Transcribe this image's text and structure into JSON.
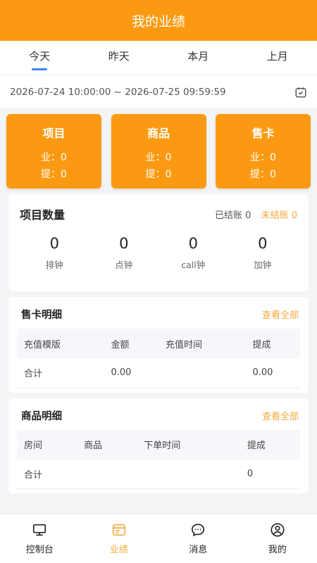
{
  "header": {
    "title": "我的业绩"
  },
  "tabs": [
    {
      "label": "今天",
      "active": true
    },
    {
      "label": "昨天",
      "active": false
    },
    {
      "label": "本月",
      "active": false
    },
    {
      "label": "上月",
      "active": false
    }
  ],
  "daterange": {
    "text": "2026-07-24 10:00:00 ~ 2026-07-25 09:59:59"
  },
  "cards": [
    {
      "title": "项目",
      "ye": "业：0",
      "ti": "提：0"
    },
    {
      "title": "商品",
      "ye": "业：0",
      "ti": "提：0"
    },
    {
      "title": "售卡",
      "ye": "业：0",
      "ti": "提：0"
    }
  ],
  "project_count": {
    "title": "项目数量",
    "settled": "已结账 0",
    "unsettled": "未结账 0",
    "items": [
      {
        "num": "0",
        "label": "排钟"
      },
      {
        "num": "0",
        "label": "点钟"
      },
      {
        "num": "0",
        "label": "call钟"
      },
      {
        "num": "0",
        "label": "加钟"
      }
    ]
  },
  "card_detail": {
    "title": "售卡明细",
    "view_all": "查看全部",
    "headers": [
      "充值模版",
      "金额",
      "充值时间",
      "提成"
    ],
    "total_row": [
      "合计",
      "0.00",
      "",
      "0.00"
    ]
  },
  "goods_detail": {
    "title": "商品明细",
    "view_all": "查看全部",
    "headers": [
      "房间",
      "商品",
      "下单时间",
      "提成"
    ],
    "total_row": [
      "合计",
      "",
      "",
      "0"
    ]
  },
  "nav": [
    {
      "label": "控制台",
      "icon": "monitor-icon"
    },
    {
      "label": "业绩",
      "icon": "performance-icon"
    },
    {
      "label": "消息",
      "icon": "chat-icon"
    },
    {
      "label": "我的",
      "icon": "user-icon"
    }
  ],
  "colors": {
    "accent": "#fb9a12",
    "tab_indicator": "#3b82f6",
    "link": "#f2a93b"
  }
}
